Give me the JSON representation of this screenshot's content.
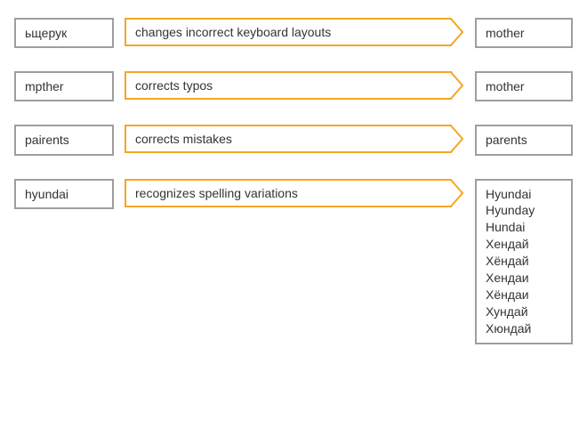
{
  "rows": [
    {
      "input": "ьщерук",
      "transform": "changes incorrect keyboard layouts",
      "output": [
        "mother"
      ]
    },
    {
      "input": "mpther",
      "transform": "corrects typos",
      "output": [
        "mother"
      ]
    },
    {
      "input": "pairents",
      "transform": "corrects mistakes",
      "output": [
        "parents"
      ]
    },
    {
      "input": "hyundai",
      "transform": "recognizes spelling variations",
      "output": [
        "Hyundai",
        "Hyunday",
        "Hundai",
        "Хендай",
        "Хёндай",
        "Хендаи",
        "Хёндаи",
        "Хундай",
        "Хюндай"
      ]
    }
  ],
  "colors": {
    "box_border": "#9e9e9e",
    "arrow": "#f5a623"
  }
}
